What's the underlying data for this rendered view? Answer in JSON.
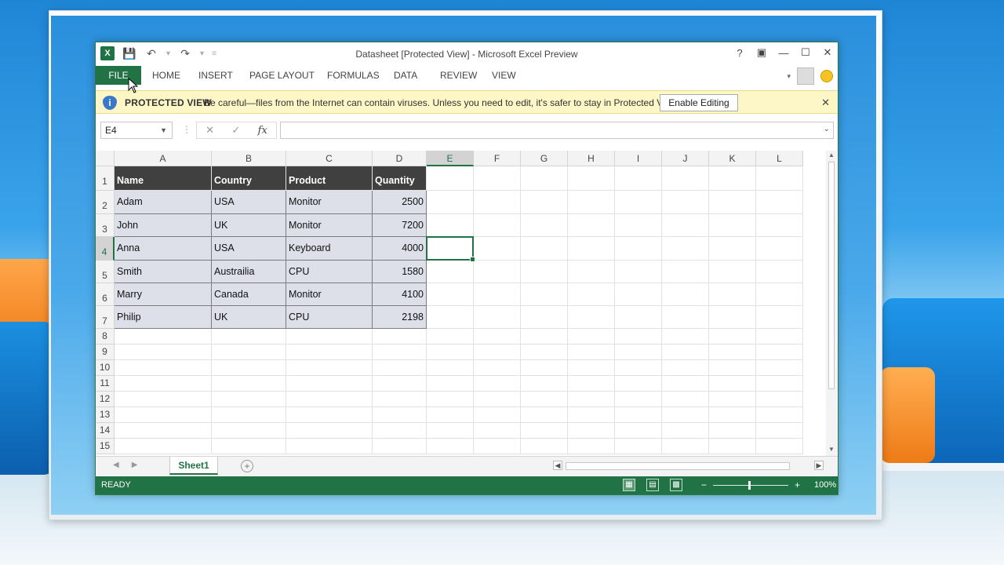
{
  "window": {
    "title": "Datasheet  [Protected View] - Microsoft Excel Preview",
    "help": "?",
    "controls": [
      "restore",
      "minimize",
      "maximize",
      "close"
    ]
  },
  "ribbon": {
    "tabs": [
      "FILE",
      "HOME",
      "INSERT",
      "PAGE LAYOUT",
      "FORMULAS",
      "DATA",
      "REVIEW",
      "VIEW"
    ]
  },
  "protected_view": {
    "label": "PROTECTED VIEW",
    "message": "Be careful—files from the Internet can contain viruses. Unless you need to edit, it's safer to stay in Protected View.",
    "button": "Enable Editing"
  },
  "formula_bar": {
    "name_box": "E4",
    "fx": "fx",
    "formula": ""
  },
  "columns": [
    "A",
    "B",
    "C",
    "D",
    "E",
    "F",
    "G",
    "H",
    "I",
    "J",
    "K",
    "L"
  ],
  "rows": [
    "1",
    "2",
    "3",
    "4",
    "5",
    "6",
    "7",
    "8",
    "9",
    "10",
    "11",
    "12",
    "13",
    "14",
    "15"
  ],
  "table": {
    "headers": [
      "Name",
      "Country",
      "Product",
      "Quantity"
    ],
    "rows": [
      [
        "Adam",
        "USA",
        "Monitor",
        "2500"
      ],
      [
        "John",
        "UK",
        "Monitor",
        "7200"
      ],
      [
        "Anna",
        "USA",
        "Keyboard",
        "4000"
      ],
      [
        "Smith",
        "Austrailia",
        "CPU",
        "1580"
      ],
      [
        "Marry",
        "Canada",
        "Monitor",
        "4100"
      ],
      [
        "Philip",
        "UK",
        "CPU",
        "2198"
      ]
    ]
  },
  "active_cell": "E4",
  "sheets": [
    "Sheet1"
  ],
  "status": {
    "ready": "READY",
    "zoom": "100%"
  },
  "colors": {
    "excel_green": "#217346",
    "header_fill": "#404040",
    "body_fill": "#dde0e8",
    "message_bar": "#fdf7c7"
  }
}
